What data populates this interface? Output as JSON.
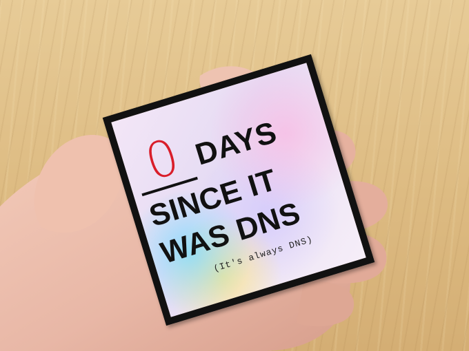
{
  "sticker": {
    "numeral": "0",
    "line1": "DAYS",
    "line2": "SINCE IT",
    "line3": "WAS DNS",
    "tagline": "(It's always DNS)"
  },
  "colors": {
    "numeral": "#d91e2a",
    "text": "#111111",
    "border": "#111111",
    "table_wood": "#ddbb82",
    "skin": "#e8b7a6"
  }
}
